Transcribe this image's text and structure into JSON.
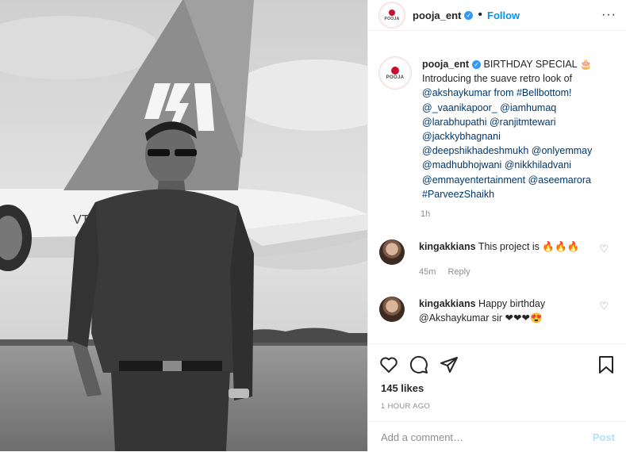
{
  "header": {
    "username": "pooja_ent",
    "separator": "•",
    "follow_label": "Follow",
    "more_label": "···",
    "avatar_word": "POOJA"
  },
  "photo": {
    "tail_text": "VT"
  },
  "caption": {
    "username": "pooja_ent",
    "lines": [
      " BIRTHDAY SPECIAL 🎂",
      "Introducing the suave retro look of",
      "@akshaykumar from #Bellbottom!",
      "@_vaanikapoor_ @iamhumaq",
      "@larabhupathi @ranjitmtewari",
      "@jackkybhagnani",
      "@deepshikhadeshmukh @onlyemmay",
      "@madhubhojwani @nikkhiladvani",
      "@emmayentertainment @aseemarora",
      "#ParveezShaikh"
    ],
    "time": "1h"
  },
  "comments": [
    {
      "username": "kingakkians",
      "text": " This project is 🔥🔥🔥",
      "time": "45m",
      "reply": "Reply"
    },
    {
      "username": "kingakkians",
      "text": " Happy birthday @Akshaykumar sir ❤❤❤😍",
      "time": "",
      "reply": ""
    }
  ],
  "actions": {
    "likes": "145 likes",
    "ago": "1 HOUR AGO"
  },
  "add_comment": {
    "placeholder": "Add a comment…",
    "post_label": "Post"
  }
}
